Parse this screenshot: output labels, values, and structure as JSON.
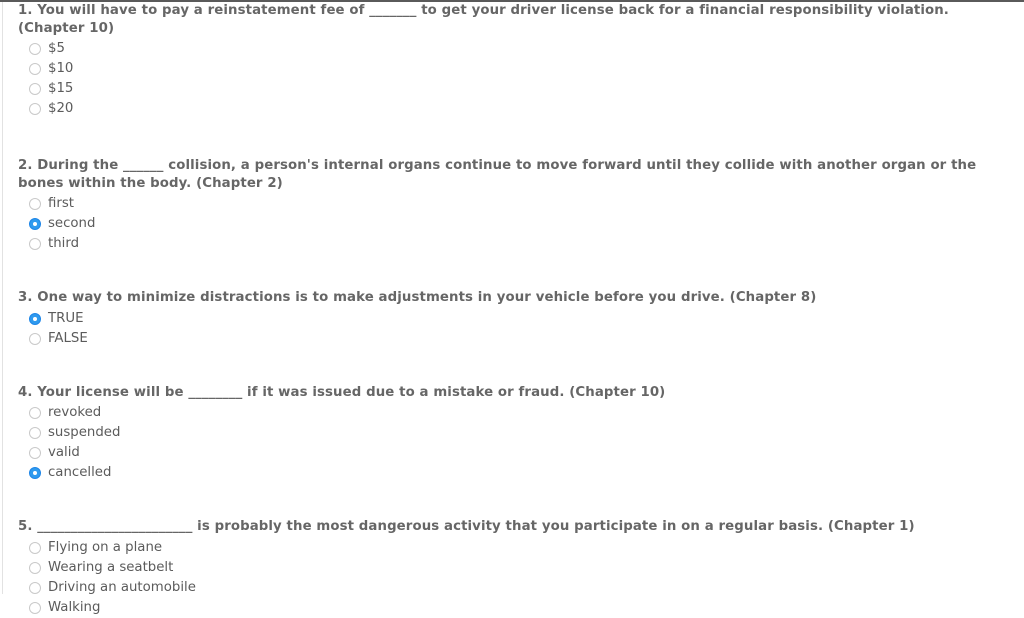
{
  "page": {
    "type": "quiz-form",
    "accent_color": "#2f9aee",
    "question_text_color": "#666666",
    "option_text_color": "#5b5b5b",
    "radio_unselected_border": "#c9c9c9"
  },
  "questions": [
    {
      "number": "1.",
      "text_before": "You will have to pay a reinstatement fee of",
      "blank": "_______",
      "text_after": "to get your driver license back for a financial responsibility violation. (Chapter 10)",
      "full_text": "1. You will have to pay a reinstatement fee of _______ to get your driver license back for a financial responsibility violation. (Chapter 10)",
      "options": [
        {
          "label": "$5",
          "selected": false
        },
        {
          "label": "$10",
          "selected": false
        },
        {
          "label": "$15",
          "selected": false
        },
        {
          "label": "$20",
          "selected": false
        }
      ]
    },
    {
      "number": "2.",
      "text_before": "During the",
      "blank": "______",
      "text_after": "collision, a person's internal organs continue to move forward until they collide with another organ or the bones within the body. (Chapter 2)",
      "full_text": "2. During the ______ collision, a person's internal organs continue to move forward until they collide with another organ or the bones within the body. (Chapter 2)",
      "options": [
        {
          "label": "first",
          "selected": false
        },
        {
          "label": "second",
          "selected": true
        },
        {
          "label": "third",
          "selected": false
        }
      ]
    },
    {
      "number": "3.",
      "text_before": "One way to minimize distractions is to make adjustments in your vehicle before you drive. (Chapter 8)",
      "blank": "",
      "text_after": "",
      "full_text": "3. One way to minimize distractions is to make adjustments in your vehicle before you drive. (Chapter 8)",
      "options": [
        {
          "label": "TRUE",
          "selected": true
        },
        {
          "label": "FALSE",
          "selected": false
        }
      ]
    },
    {
      "number": "4.",
      "text_before": "Your license will be",
      "blank": "________",
      "text_after": "if it was issued due to a mistake or fraud. (Chapter 10)",
      "full_text": "4. Your license will be ________ if it was issued due to a mistake or fraud. (Chapter 10)",
      "options": [
        {
          "label": "revoked",
          "selected": false
        },
        {
          "label": "suspended",
          "selected": false
        },
        {
          "label": "valid",
          "selected": false
        },
        {
          "label": "cancelled",
          "selected": true
        }
      ]
    },
    {
      "number": "5.",
      "text_before": "",
      "blank": "_______________________",
      "text_after": "is probably the most dangerous activity that you participate in on a regular basis. (Chapter 1)",
      "full_text": "5. _______________________ is probably the most dangerous activity that you participate in on a regular basis. (Chapter 1)",
      "options": [
        {
          "label": "Flying on a plane",
          "selected": false
        },
        {
          "label": "Wearing a seatbelt",
          "selected": false
        },
        {
          "label": "Driving an automobile",
          "selected": false
        },
        {
          "label": "Walking",
          "selected": false
        }
      ]
    }
  ]
}
